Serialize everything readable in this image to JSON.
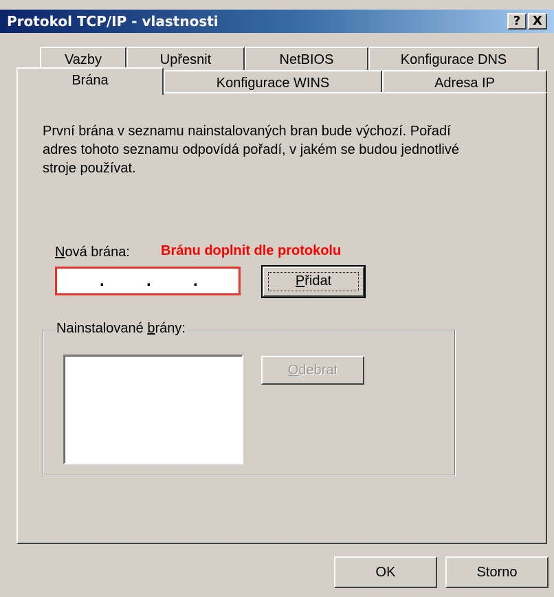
{
  "window": {
    "title": "Protokol TCP/IP - vlastnosti",
    "help_button": "?",
    "close_button": "X"
  },
  "tabs": {
    "back_row": [
      "Vazby",
      "Upřesnit",
      "NetBIOS",
      "Konfigurace DNS"
    ],
    "front_row": [
      "Brána",
      "Konfigurace WINS",
      "Adresa IP"
    ],
    "active": "Brána"
  },
  "gateway_page": {
    "description": "První brána v seznamu nainstalovaných bran bude výchozí. Pořadí adres tohoto seznamu odpovídá pořadí, v jakém se budou jednotlivé stroje používat.",
    "new_gateway": {
      "label_accel": "N",
      "label_rest": "ová brána:",
      "note": "Bránu doplnit dle protokolu",
      "ip_value": ". . .",
      "add_button_accel": "P",
      "add_button_rest": "řidat"
    },
    "installed": {
      "group_title_pre": "Nainstalované ",
      "group_title_accel": "b",
      "group_title_post": "rány:",
      "items": [],
      "remove_button_accel": "O",
      "remove_button_rest": "debrat",
      "remove_enabled": false
    }
  },
  "footer": {
    "ok_label": "OK",
    "cancel_label": "Storno"
  },
  "colors": {
    "title_gradient_start": "#0a246a",
    "title_gradient_end": "#a6caf0",
    "face": "#d4d0c8",
    "note_red": "#ff0000"
  }
}
